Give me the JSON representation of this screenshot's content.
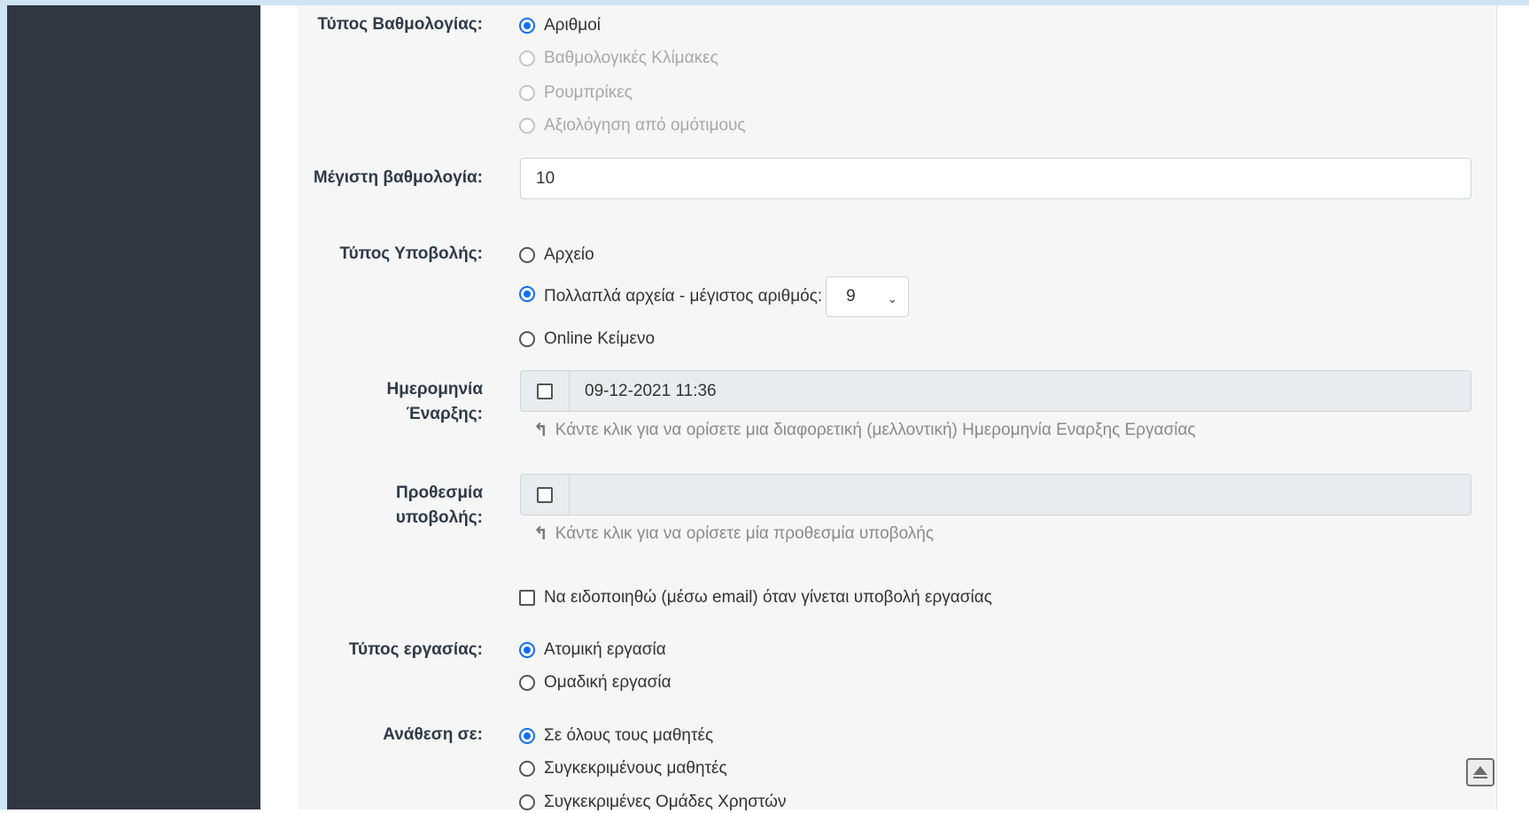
{
  "grading_type": {
    "label": "Τύπος Βαθμολογίας:",
    "options": [
      {
        "label": "Αριθμοί",
        "checked": true,
        "disabled": false
      },
      {
        "label": "Βαθμολογικές Κλίμακες",
        "checked": false,
        "disabled": true
      },
      {
        "label": "Ρουμπρίκες",
        "checked": false,
        "disabled": true
      },
      {
        "label": "Αξιολόγηση από ομότιμους",
        "checked": false,
        "disabled": true
      }
    ]
  },
  "max_grade": {
    "label": "Μέγιστη βαθμολογία:",
    "value": "10"
  },
  "submission_type": {
    "label": "Τύπος Υποβολής:",
    "options": [
      {
        "label": "Αρχείο",
        "checked": false
      },
      {
        "label": "Πολλαπλά αρχεία - μέγιστος αριθμός:",
        "checked": true
      },
      {
        "label": "Online Κείμενο",
        "checked": false
      }
    ],
    "max_files_value": "9"
  },
  "start_date": {
    "label": "Ημερομηνία Έναρξης:",
    "value": "09-12-2021 11:36",
    "hint": "Κάντε κλικ για να ορίσετε μια διαφορετική (μελλοντική) Ημερομηνία Εναρξης Εργασίας"
  },
  "deadline": {
    "label": "Προθεσμία υποβολής:",
    "value": "",
    "hint": "Κάντε κλικ για να ορίσετε μία προθεσμία υποβολής"
  },
  "notify": {
    "label": "Να ειδοποιηθώ (μέσω email) όταν γίνεται υποβολή εργασίας"
  },
  "assignment_type": {
    "label": "Τύπος εργασίας:",
    "options": [
      {
        "label": "Ατομική εργασία",
        "checked": true
      },
      {
        "label": "Ομαδική εργασία",
        "checked": false
      }
    ]
  },
  "assign_to": {
    "label": "Ανάθεση σε:",
    "options": [
      {
        "label": "Σε όλους τους μαθητές",
        "checked": true
      },
      {
        "label": "Συγκεκριμένους μαθητές",
        "checked": false
      },
      {
        "label": "Συγκεκριμένες Ομάδες Χρηστών",
        "checked": false
      }
    ]
  },
  "icons": {
    "hint_arrow": "↰",
    "scroll_top": "scroll-top-icon",
    "select_chevron": "chevron-down-icon"
  },
  "colors": {
    "accent": "#0d6efd",
    "sidebar": "#31363f",
    "label": "#2e3a49"
  }
}
